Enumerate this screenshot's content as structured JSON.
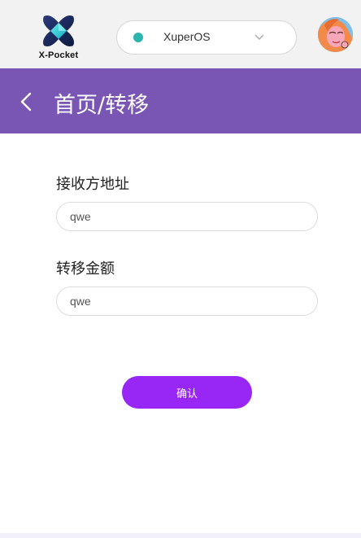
{
  "app": {
    "logo_text": "X-Pocket"
  },
  "network": {
    "selected": "XuperOS",
    "status_color": "#2cb5ad"
  },
  "header": {
    "title": "首页/转移",
    "background": "#7955b4"
  },
  "form": {
    "recipient_label": "接收方地址",
    "recipient_value": "qwe",
    "amount_label": "转移金额",
    "amount_value": "qwe"
  },
  "actions": {
    "confirm_label": "确认",
    "confirm_color": "#9826f5"
  }
}
